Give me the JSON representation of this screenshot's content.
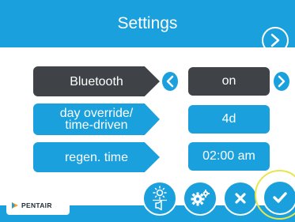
{
  "header": {
    "title": "Settings"
  },
  "rows": [
    {
      "label": "Bluetooth",
      "value": "on"
    },
    {
      "label": "day override/\ntime-driven",
      "value": "4d"
    },
    {
      "label": "regen. time",
      "value": "02:00 am"
    }
  ],
  "footer": {
    "logo_text": "PENTAIR",
    "buttons": [
      "brightness-volume",
      "settings",
      "cancel",
      "confirm"
    ]
  },
  "colors": {
    "primary": "#1aa0dc",
    "selected": "#3f4347",
    "highlight_ring": "#e6e64a"
  }
}
